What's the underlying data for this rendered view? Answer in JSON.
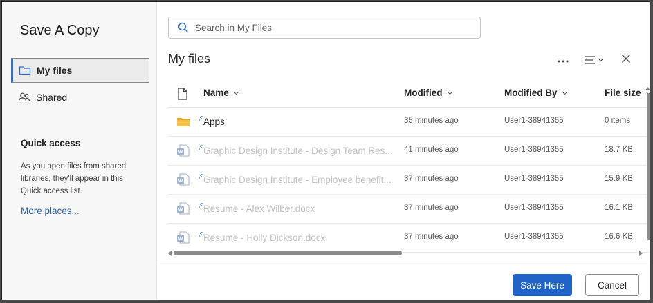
{
  "dialog": {
    "title": "Save A Copy"
  },
  "nav": {
    "items": [
      {
        "label": "My files",
        "icon": "folder-icon",
        "selected": true
      },
      {
        "label": "Shared",
        "icon": "people-icon",
        "selected": false
      }
    ]
  },
  "quick_access": {
    "title": "Quick access",
    "description": "As you open files from shared libraries, they'll appear in this Quick access list.",
    "more_link": "More places..."
  },
  "search": {
    "placeholder": "Search in My Files",
    "value": ""
  },
  "folder": {
    "title": "My files"
  },
  "toolbar": {
    "more_icon": "more-horizontal-icon",
    "view_icon": "list-view-icon",
    "close_icon": "close-icon"
  },
  "columns": {
    "type_icon": "file-icon",
    "name": "Name",
    "modified": "Modified",
    "modified_by": "Modified By",
    "file_size": "File size"
  },
  "rows": [
    {
      "name": "Apps",
      "modified": "35 minutes ago",
      "modified_by": "User1-38941355",
      "size": "0 items",
      "type": "folder",
      "dim": false
    },
    {
      "name": "Graphic Design Institute - Design Team Res...",
      "modified": "41 minutes ago",
      "modified_by": "User1-38941355",
      "size": "18.7 KB",
      "type": "word",
      "dim": true
    },
    {
      "name": "Graphic Design Institute - Employee benefit...",
      "modified": "37 minutes ago",
      "modified_by": "User1-38941355",
      "size": "15.9 KB",
      "type": "word",
      "dim": true
    },
    {
      "name": "Resume - Alex Wilber.docx",
      "modified": "37 minutes ago",
      "modified_by": "User1-38941355",
      "size": "16.1 KB",
      "type": "word",
      "dim": true
    },
    {
      "name": "Resume - Holly Dickson.docx",
      "modified": "37 minutes ago",
      "modified_by": "User1-38941355",
      "size": "16.6 KB",
      "type": "word",
      "dim": true
    }
  ],
  "actions": {
    "primary": "Save Here",
    "secondary": "Cancel"
  },
  "colors": {
    "accent": "#1f63c6",
    "folder": "#f4b531",
    "word": "#2b579a",
    "link": "#2a62b0"
  }
}
